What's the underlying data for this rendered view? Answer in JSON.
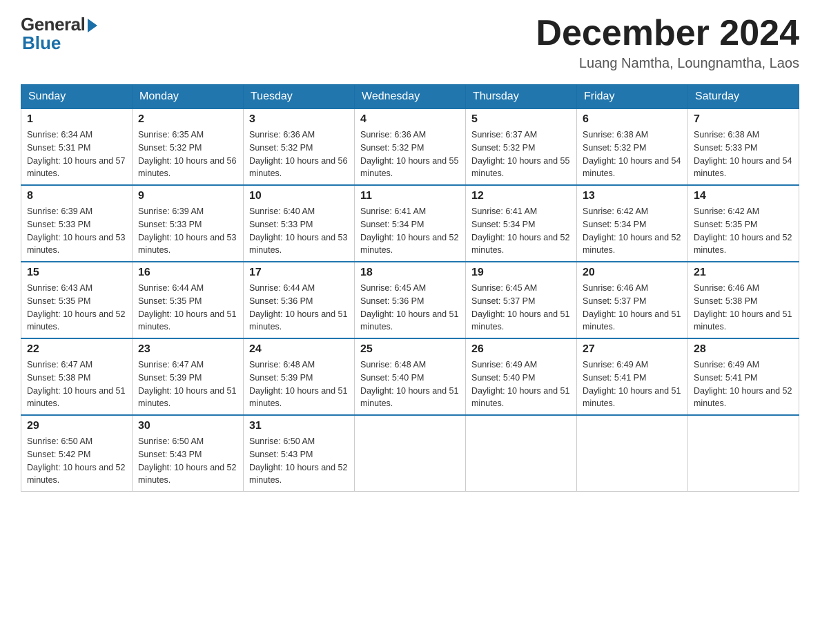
{
  "logo": {
    "general": "General",
    "blue": "Blue"
  },
  "title": "December 2024",
  "location": "Luang Namtha, Loungnamtha, Laos",
  "days_of_week": [
    "Sunday",
    "Monday",
    "Tuesday",
    "Wednesday",
    "Thursday",
    "Friday",
    "Saturday"
  ],
  "weeks": [
    [
      {
        "day": "1",
        "sunrise": "6:34 AM",
        "sunset": "5:31 PM",
        "daylight": "10 hours and 57 minutes."
      },
      {
        "day": "2",
        "sunrise": "6:35 AM",
        "sunset": "5:32 PM",
        "daylight": "10 hours and 56 minutes."
      },
      {
        "day": "3",
        "sunrise": "6:36 AM",
        "sunset": "5:32 PM",
        "daylight": "10 hours and 56 minutes."
      },
      {
        "day": "4",
        "sunrise": "6:36 AM",
        "sunset": "5:32 PM",
        "daylight": "10 hours and 55 minutes."
      },
      {
        "day": "5",
        "sunrise": "6:37 AM",
        "sunset": "5:32 PM",
        "daylight": "10 hours and 55 minutes."
      },
      {
        "day": "6",
        "sunrise": "6:38 AM",
        "sunset": "5:32 PM",
        "daylight": "10 hours and 54 minutes."
      },
      {
        "day": "7",
        "sunrise": "6:38 AM",
        "sunset": "5:33 PM",
        "daylight": "10 hours and 54 minutes."
      }
    ],
    [
      {
        "day": "8",
        "sunrise": "6:39 AM",
        "sunset": "5:33 PM",
        "daylight": "10 hours and 53 minutes."
      },
      {
        "day": "9",
        "sunrise": "6:39 AM",
        "sunset": "5:33 PM",
        "daylight": "10 hours and 53 minutes."
      },
      {
        "day": "10",
        "sunrise": "6:40 AM",
        "sunset": "5:33 PM",
        "daylight": "10 hours and 53 minutes."
      },
      {
        "day": "11",
        "sunrise": "6:41 AM",
        "sunset": "5:34 PM",
        "daylight": "10 hours and 52 minutes."
      },
      {
        "day": "12",
        "sunrise": "6:41 AM",
        "sunset": "5:34 PM",
        "daylight": "10 hours and 52 minutes."
      },
      {
        "day": "13",
        "sunrise": "6:42 AM",
        "sunset": "5:34 PM",
        "daylight": "10 hours and 52 minutes."
      },
      {
        "day": "14",
        "sunrise": "6:42 AM",
        "sunset": "5:35 PM",
        "daylight": "10 hours and 52 minutes."
      }
    ],
    [
      {
        "day": "15",
        "sunrise": "6:43 AM",
        "sunset": "5:35 PM",
        "daylight": "10 hours and 52 minutes."
      },
      {
        "day": "16",
        "sunrise": "6:44 AM",
        "sunset": "5:35 PM",
        "daylight": "10 hours and 51 minutes."
      },
      {
        "day": "17",
        "sunrise": "6:44 AM",
        "sunset": "5:36 PM",
        "daylight": "10 hours and 51 minutes."
      },
      {
        "day": "18",
        "sunrise": "6:45 AM",
        "sunset": "5:36 PM",
        "daylight": "10 hours and 51 minutes."
      },
      {
        "day": "19",
        "sunrise": "6:45 AM",
        "sunset": "5:37 PM",
        "daylight": "10 hours and 51 minutes."
      },
      {
        "day": "20",
        "sunrise": "6:46 AM",
        "sunset": "5:37 PM",
        "daylight": "10 hours and 51 minutes."
      },
      {
        "day": "21",
        "sunrise": "6:46 AM",
        "sunset": "5:38 PM",
        "daylight": "10 hours and 51 minutes."
      }
    ],
    [
      {
        "day": "22",
        "sunrise": "6:47 AM",
        "sunset": "5:38 PM",
        "daylight": "10 hours and 51 minutes."
      },
      {
        "day": "23",
        "sunrise": "6:47 AM",
        "sunset": "5:39 PM",
        "daylight": "10 hours and 51 minutes."
      },
      {
        "day": "24",
        "sunrise": "6:48 AM",
        "sunset": "5:39 PM",
        "daylight": "10 hours and 51 minutes."
      },
      {
        "day": "25",
        "sunrise": "6:48 AM",
        "sunset": "5:40 PM",
        "daylight": "10 hours and 51 minutes."
      },
      {
        "day": "26",
        "sunrise": "6:49 AM",
        "sunset": "5:40 PM",
        "daylight": "10 hours and 51 minutes."
      },
      {
        "day": "27",
        "sunrise": "6:49 AM",
        "sunset": "5:41 PM",
        "daylight": "10 hours and 51 minutes."
      },
      {
        "day": "28",
        "sunrise": "6:49 AM",
        "sunset": "5:41 PM",
        "daylight": "10 hours and 52 minutes."
      }
    ],
    [
      {
        "day": "29",
        "sunrise": "6:50 AM",
        "sunset": "5:42 PM",
        "daylight": "10 hours and 52 minutes."
      },
      {
        "day": "30",
        "sunrise": "6:50 AM",
        "sunset": "5:43 PM",
        "daylight": "10 hours and 52 minutes."
      },
      {
        "day": "31",
        "sunrise": "6:50 AM",
        "sunset": "5:43 PM",
        "daylight": "10 hours and 52 minutes."
      },
      null,
      null,
      null,
      null
    ]
  ]
}
